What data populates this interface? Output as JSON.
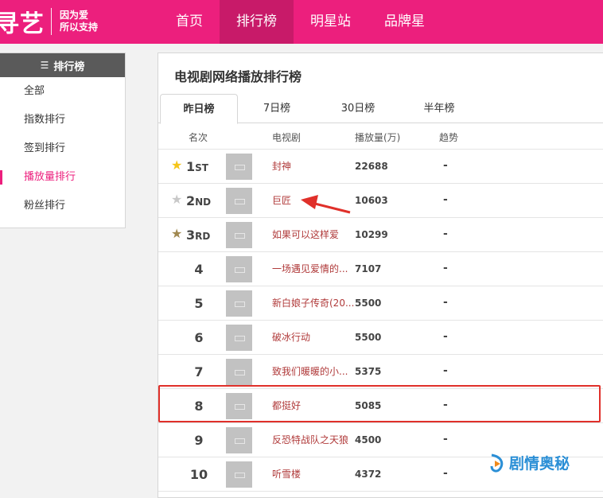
{
  "logo": {
    "main": "寻艺",
    "slogan_line1": "因为爱",
    "slogan_line2": "所以支持"
  },
  "nav": {
    "items": [
      "首页",
      "排行榜",
      "明星站",
      "品牌星"
    ],
    "active": 1
  },
  "sidebar": {
    "header": "排行榜",
    "icon": "list-icon",
    "items": [
      "全部",
      "指数排行",
      "签到排行",
      "播放量排行",
      "粉丝排行"
    ],
    "active": 3
  },
  "panel": {
    "title": "电视剧网络播放排行榜",
    "tabs": [
      "昨日榜",
      "7日榜",
      "30日榜",
      "半年榜"
    ],
    "active_tab": 0,
    "headers": {
      "rank": "名次",
      "drama": "电视剧",
      "plays": "播放量(万)",
      "trend": "趋势"
    },
    "rows": [
      {
        "rank": "1",
        "suffix": "ST",
        "star": "gold",
        "title": "封神",
        "plays": "22688",
        "trend": "-"
      },
      {
        "rank": "2",
        "suffix": "ND",
        "star": "silver",
        "title": "巨匠",
        "plays": "10603",
        "trend": "-"
      },
      {
        "rank": "3",
        "suffix": "RD",
        "star": "bronze",
        "title": "如果可以这样爱",
        "plays": "10299",
        "trend": "-"
      },
      {
        "rank": "4",
        "suffix": "",
        "star": "",
        "title": "一场遇见爱情的...",
        "plays": "7107",
        "trend": "-"
      },
      {
        "rank": "5",
        "suffix": "",
        "star": "",
        "title": "新白娘子传奇(20...",
        "plays": "5500",
        "trend": "-"
      },
      {
        "rank": "6",
        "suffix": "",
        "star": "",
        "title": "破冰行动",
        "plays": "5500",
        "trend": "-"
      },
      {
        "rank": "7",
        "suffix": "",
        "star": "",
        "title": "致我们暖暖的小...",
        "plays": "5375",
        "trend": "-"
      },
      {
        "rank": "8",
        "suffix": "",
        "star": "",
        "title": "都挺好",
        "plays": "5085",
        "trend": "-"
      },
      {
        "rank": "9",
        "suffix": "",
        "star": "",
        "title": "反恐特战队之天狼",
        "plays": "4500",
        "trend": "-"
      },
      {
        "rank": "10",
        "suffix": "",
        "star": "",
        "title": "听雪楼",
        "plays": "4372",
        "trend": "-"
      }
    ]
  },
  "star_colors": {
    "gold": "#f5c518",
    "silver": "#c8c8c8",
    "bronze": "#a08850"
  },
  "accent": "#ec1f7d",
  "watermark": {
    "text": "剧情奥秘",
    "icon": "play-logo-icon"
  }
}
